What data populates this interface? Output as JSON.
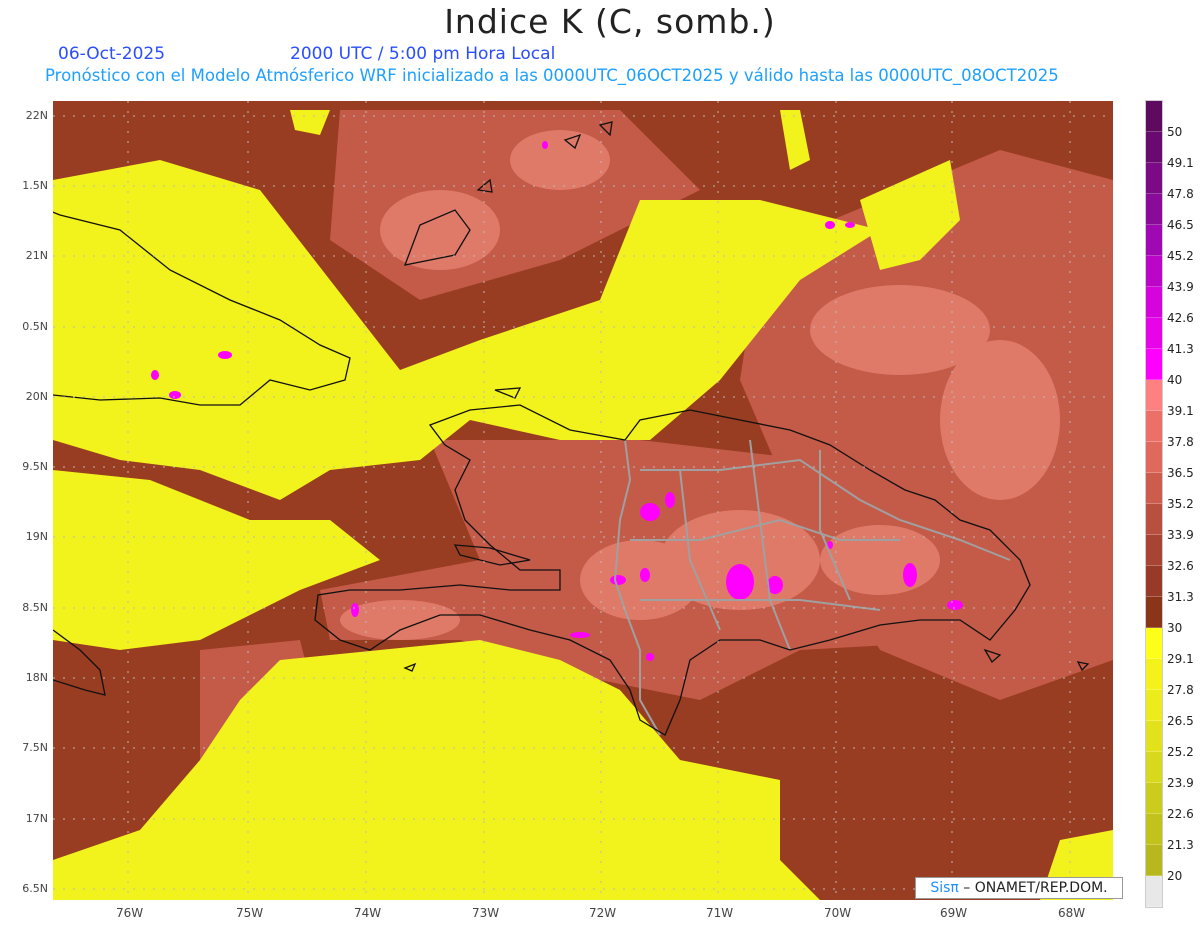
{
  "header": {
    "title": "Indice K (C, somb.)",
    "date": "06-Oct-2025",
    "time": "2000 UTC / 5:00 pm Hora Local",
    "subtitle": "Pronóstico con el Modelo Atmósferico WRF inicializado a las 0000UTC_06OCT2025 y válido hasta las  0000UTC_08OCT2025"
  },
  "axes": {
    "lat_labels": [
      "22N",
      "1.5N",
      "21N",
      "0.5N",
      "20N",
      "9.5N",
      "19N",
      "8.5N",
      "18N",
      "7.5N",
      "17N",
      "6.5N"
    ],
    "lon_labels": [
      "76W",
      "75W",
      "74W",
      "73W",
      "72W",
      "71W",
      "70W",
      "69W",
      "68W"
    ]
  },
  "colorbar": {
    "labels": [
      "50",
      "49.1",
      "47.8",
      "46.5",
      "45.2",
      "43.9",
      "42.6",
      "41.3",
      "40",
      "39.1",
      "37.8",
      "36.5",
      "35.2",
      "33.9",
      "32.6",
      "31.3",
      "30",
      "29.1",
      "27.8",
      "26.5",
      "25.2",
      "23.9",
      "22.6",
      "21.3",
      "20"
    ],
    "colors": [
      "#5e0a5e",
      "#6a0a70",
      "#7a0a85",
      "#8a0a9a",
      "#a008b4",
      "#bb06c8",
      "#d504dc",
      "#e804e8",
      "#ff00ff",
      "#ff8080",
      "#ec7068",
      "#df6a5c",
      "#cd5c4c",
      "#b85040",
      "#a84434",
      "#983a28",
      "#8a3418",
      "#ffff1a",
      "#f4f21a",
      "#ecec1c",
      "#e2e21c",
      "#d8d81c",
      "#cccc1c",
      "#c2c21c",
      "#b8b81e",
      "#e8e8e8"
    ]
  },
  "credit": {
    "brand": "Sisπ",
    "text": " – ONAMET/REP.DOM."
  }
}
